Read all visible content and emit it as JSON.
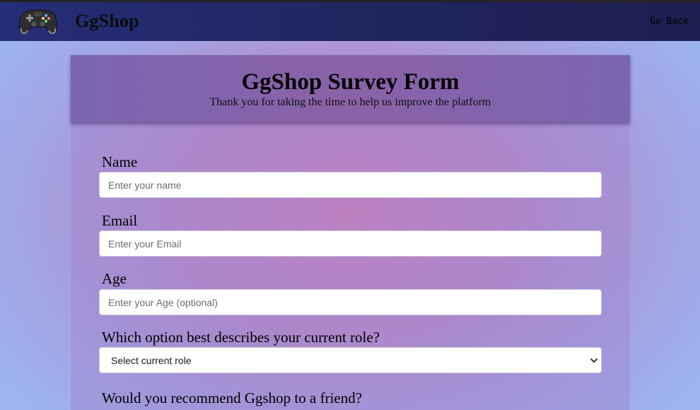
{
  "navbar": {
    "brand": "GgShop",
    "logo_icon": "gamepad-icon",
    "go_back": "Go Back"
  },
  "form": {
    "title": "GgShop Survey Form",
    "subtitle": "Thank you for taking the time to help us improve the platform",
    "name": {
      "label": "Name",
      "placeholder": "Enter your name",
      "value": ""
    },
    "email": {
      "label": "Email",
      "placeholder": "Enter your Email",
      "value": ""
    },
    "age": {
      "label": "Age",
      "placeholder": "Enter your Age (optional)",
      "value": ""
    },
    "role": {
      "label": "Which option best describes your current role?",
      "selected": "Select current role",
      "icon": "chevron-down-icon"
    },
    "recommend": {
      "label": "Would you recommend Ggshop to a friend?"
    }
  },
  "colors": {
    "navbar": "#212560",
    "header": "#8a62a8",
    "background_center": "#d27fb8",
    "background_edge": "#9cb5ef"
  }
}
